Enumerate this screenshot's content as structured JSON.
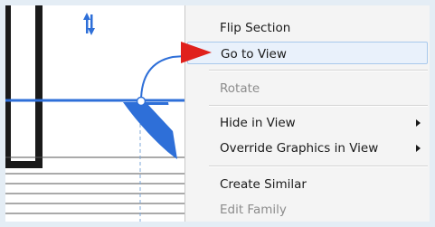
{
  "context_menu": {
    "items": [
      {
        "label": "Flip Section",
        "enabled": true,
        "submenu": false
      },
      {
        "label": "Go to View",
        "enabled": true,
        "submenu": false,
        "highlighted": true
      },
      {
        "label": "Rotate",
        "enabled": false,
        "submenu": false
      },
      {
        "label": "Hide in View",
        "enabled": true,
        "submenu": true
      },
      {
        "label": "Override Graphics in View",
        "enabled": true,
        "submenu": true
      },
      {
        "label": "Create Similar",
        "enabled": true,
        "submenu": false
      },
      {
        "label": "Edit Family",
        "enabled": false,
        "submenu": false
      }
    ]
  },
  "annotation": {
    "arrow_color": "#e0211c",
    "arrow_target": "Go to View"
  },
  "drawing": {
    "section_line_color": "#2e6fd8",
    "wall_color": "#1a1a1a"
  }
}
